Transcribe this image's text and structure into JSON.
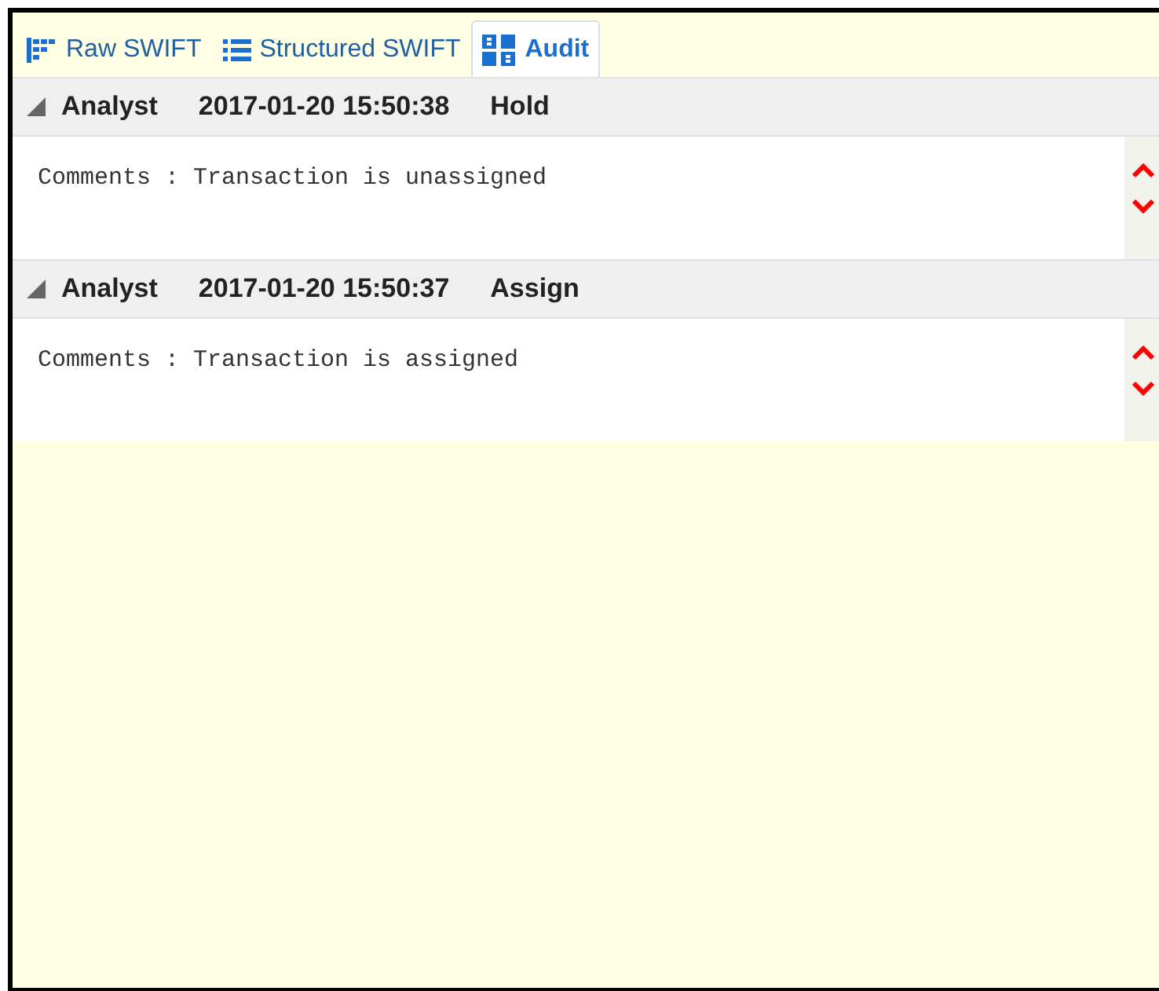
{
  "tabs": [
    {
      "label": "Raw SWIFT",
      "kind": "raw",
      "selected": false
    },
    {
      "label": "Structured SWIFT",
      "kind": "list",
      "selected": false
    },
    {
      "label": "Audit",
      "kind": "grid",
      "selected": true
    }
  ],
  "entries": [
    {
      "user": "Analyst",
      "timestamp": "2017-01-20 15:50:38",
      "action": "Hold",
      "comment": "Comments : Transaction is unassigned"
    },
    {
      "user": "Analyst",
      "timestamp": "2017-01-20 15:50:37",
      "action": "Assign",
      "comment": "Comments : Transaction is assigned"
    }
  ]
}
